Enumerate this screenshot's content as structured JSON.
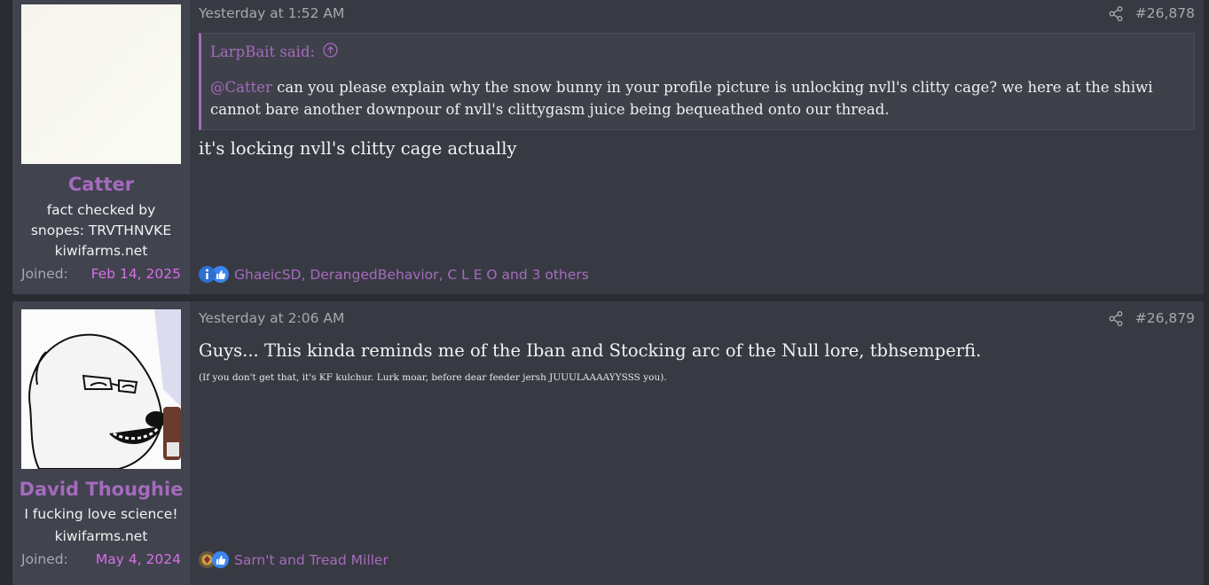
{
  "posts": [
    {
      "author": "Catter",
      "user_title": "fact checked by snopes: TRVTHNVKE kiwifarms.net",
      "joined_label": "Joined:",
      "joined_date": "Feb 14, 2025",
      "time": "Yesterday at 1:52 AM",
      "post_number": "#26,878",
      "quote": {
        "author_line": "LarpBait said:",
        "mention": "@Catter",
        "text": " can you please explain why the snow bunny in your profile picture is unlocking nvll's clitty cage? we here at the shiwi cannot bare another downpour of nvll's clittygasm juice being bequeathed onto our thread."
      },
      "message": "it's locking nvll's clitty cage actually",
      "reactions": "GhaeicSD, DerangedBehavior, C L E O and 3 others",
      "reaction_icons": [
        "info-icon",
        "thumbs-up-icon"
      ]
    },
    {
      "author": "David Thoughie",
      "user_title_1": "I fucking love science!",
      "user_title_2": "kiwifarms.net",
      "joined_label": "Joined:",
      "joined_date": "May 4, 2024",
      "time": "Yesterday at 2:06 AM",
      "post_number": "#26,879",
      "message": "Guys... This kinda reminds me of the Iban and Stocking arc of the Null lore, tbhsemperfi.",
      "small_text": "(If you don't get that, it's KF kulchur. Lurk moar, before dear feeder jersh JUUULAAAAYYSSS you).",
      "reactions": "Sarn't and Tread Miller",
      "reaction_icons": [
        "emblem-icon",
        "thumbs-up-icon"
      ]
    }
  ],
  "colors": {
    "accent": "#a46bbd",
    "joined_date": "#d66fe6",
    "post_bg": "#383a43",
    "user_col_bg": "#41434e"
  }
}
